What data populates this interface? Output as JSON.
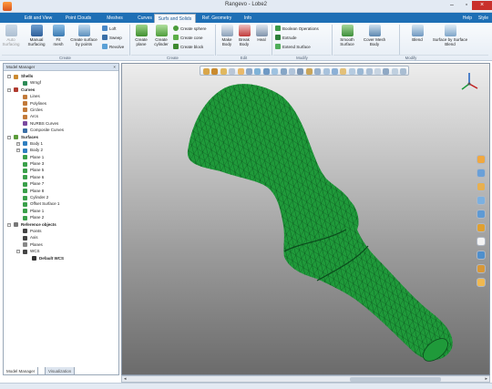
{
  "app": {
    "title": "Rangevo - Lobe2"
  },
  "menu": {
    "tabs": [
      "Edit and View",
      "Point Clouds",
      "Meshes",
      "Curves",
      "Surfs and Solids",
      "Ref. Geometry",
      "Info"
    ],
    "active_tab": "Surfs and Solids",
    "help": "Help",
    "style": "Style"
  },
  "ribbon": {
    "buttons": [
      {
        "label": "Auto Surfacing",
        "icon": "auto-surfacing-icon",
        "disabled": true
      },
      {
        "label": "Manual Surfacing",
        "icon": "manual-surfacing-icon"
      },
      {
        "label": "Fit mesh",
        "icon": "fit-mesh-icon"
      },
      {
        "label": "Create surface by points",
        "icon": "surface-points-icon"
      },
      {
        "label": "Create plane",
        "icon": "create-plane-icon"
      },
      {
        "label": "Create cylinder",
        "icon": "create-cylinder-icon"
      },
      {
        "label": "Make Body",
        "icon": "make-body-icon"
      },
      {
        "label": "Break Body",
        "icon": "break-body-icon"
      },
      {
        "label": "Heal",
        "icon": "heal-icon"
      },
      {
        "label": "Smooth Surface",
        "icon": "smooth-surface-icon"
      },
      {
        "label": "Cover Mesh Body",
        "icon": "cover-mesh-icon"
      },
      {
        "label": "Blend",
        "icon": "blend-icon"
      },
      {
        "label": "Surface by Surface Blend",
        "icon": "surface-blend-icon"
      }
    ],
    "small": [
      {
        "label": "Loft",
        "icon": "loft-icon"
      },
      {
        "label": "Sweep",
        "icon": "sweep-icon"
      },
      {
        "label": "Revolve",
        "icon": "revolve-icon"
      },
      {
        "label": "Create sphere",
        "icon": "sphere-icon"
      },
      {
        "label": "Create cone",
        "icon": "cone-icon"
      },
      {
        "label": "Create block",
        "icon": "block-icon"
      },
      {
        "label": "Boolean Operations",
        "icon": "boolean-icon"
      },
      {
        "label": "Extrude",
        "icon": "extrude-icon"
      },
      {
        "label": "Extend Surface",
        "icon": "extend-icon"
      }
    ],
    "groups": [
      "Create",
      "Create",
      "Edit",
      "Modify",
      "Modify"
    ]
  },
  "panel": {
    "header": "Model Manager",
    "close": "×",
    "tabs": [
      "Model Manager",
      "Visualization"
    ],
    "tree": [
      {
        "label": "Shells",
        "level": 0,
        "expander": "−",
        "icon": "shell-icon",
        "color": "#cc8a30",
        "bold": true
      },
      {
        "label": "Wrngf",
        "level": 1,
        "icon": "mesh-icon",
        "color": "#2e8b57"
      },
      {
        "label": "Curves",
        "level": 0,
        "expander": "−",
        "icon": "curve-icon",
        "color": "#b03a2e",
        "bold": true
      },
      {
        "label": "Lines",
        "level": 1,
        "icon": "line-icon",
        "color": "#c27a3a"
      },
      {
        "label": "Polylines",
        "level": 1,
        "icon": "polyline-icon",
        "color": "#c27a3a"
      },
      {
        "label": "Circles",
        "level": 1,
        "icon": "circle-icon",
        "color": "#c27a3a"
      },
      {
        "label": "Arcs",
        "level": 1,
        "icon": "arc-icon",
        "color": "#c27a3a"
      },
      {
        "label": "NURBS Curves",
        "level": 1,
        "icon": "nurbs-curve-icon",
        "color": "#7a4aa0"
      },
      {
        "label": "Composite Curves",
        "level": 1,
        "icon": "composite-curve-icon",
        "color": "#3a6ea5"
      },
      {
        "label": "Surfaces",
        "level": 0,
        "expander": "−",
        "icon": "surface-icon",
        "color": "#5b9b3a",
        "bold": true
      },
      {
        "label": "Body 1",
        "level": 1,
        "expander": "+",
        "icon": "body-icon",
        "color": "#2f7fc0"
      },
      {
        "label": "Body 2",
        "level": 1,
        "expander": "+",
        "icon": "body-icon",
        "color": "#2f7fc0"
      },
      {
        "label": "Plane 1",
        "level": 1,
        "icon": "plane-icon",
        "color": "#3aa04a"
      },
      {
        "label": "Plane 3",
        "level": 1,
        "icon": "plane-icon",
        "color": "#3aa04a"
      },
      {
        "label": "Plane 5",
        "level": 1,
        "icon": "plane-icon",
        "color": "#3aa04a"
      },
      {
        "label": "Plane 6",
        "level": 1,
        "icon": "plane-icon",
        "color": "#3aa04a"
      },
      {
        "label": "Plane 7",
        "level": 1,
        "icon": "plane-icon",
        "color": "#3aa04a"
      },
      {
        "label": "Plane 8",
        "level": 1,
        "icon": "plane-icon",
        "color": "#3aa04a"
      },
      {
        "label": "Cylinder 2",
        "level": 1,
        "icon": "cylinder-icon",
        "color": "#3aa04a"
      },
      {
        "label": "Offset Surface 1",
        "level": 1,
        "icon": "offset-surface-icon",
        "color": "#3aa04a"
      },
      {
        "label": "Plane 1",
        "level": 1,
        "icon": "plane-icon",
        "color": "#3aa04a"
      },
      {
        "label": "Plane 2",
        "level": 1,
        "icon": "plane-icon",
        "color": "#3aa04a"
      },
      {
        "label": "Reference objects",
        "level": 0,
        "expander": "−",
        "icon": "reference-icon",
        "color": "#777777",
        "bold": true
      },
      {
        "label": "Points",
        "level": 1,
        "icon": "point-icon",
        "color": "#444444"
      },
      {
        "label": "Axis",
        "level": 1,
        "icon": "axis-icon",
        "color": "#444444"
      },
      {
        "label": "Planes",
        "level": 1,
        "icon": "ref-plane-icon",
        "color": "#888888"
      },
      {
        "label": "WCS",
        "level": 1,
        "expander": "−",
        "icon": "wcs-icon",
        "color": "#444444"
      },
      {
        "label": "Default WCS",
        "level": 2,
        "icon": "default-wcs-icon",
        "color": "#333333",
        "bold": true
      }
    ]
  },
  "viewport": {
    "mesh_color": "#1f9a3a",
    "mesh_line_color": "#0b4a1c",
    "toolbar_icons": [
      "select-icon",
      "pan-icon",
      "shaded-icon",
      "wireframe-icon",
      "eraser-icon",
      "section-icon",
      "points-view-icon",
      "mesh-view-icon",
      "surface-view-icon",
      "curve-view-icon",
      "normals-icon",
      "edges-icon",
      "body-view-icon",
      "fit-icon",
      "zoom-icon",
      "clip-icon",
      "light-icon",
      "color-icon",
      "texture-icon",
      "transparency-icon",
      "camera-icon",
      "scene-icon",
      "view-a-icon",
      "view-b-icon"
    ],
    "right_tools": [
      "hand-icon",
      "rotate-icon",
      "zoom-tool-icon",
      "front-view-icon",
      "top-view-icon",
      "side-view-icon",
      "iso-view-icon",
      "fit-all-icon",
      "section-plane-icon",
      "home-icon"
    ]
  },
  "scrollbar": {
    "left_arrow": "◂",
    "right_arrow": "▸"
  }
}
